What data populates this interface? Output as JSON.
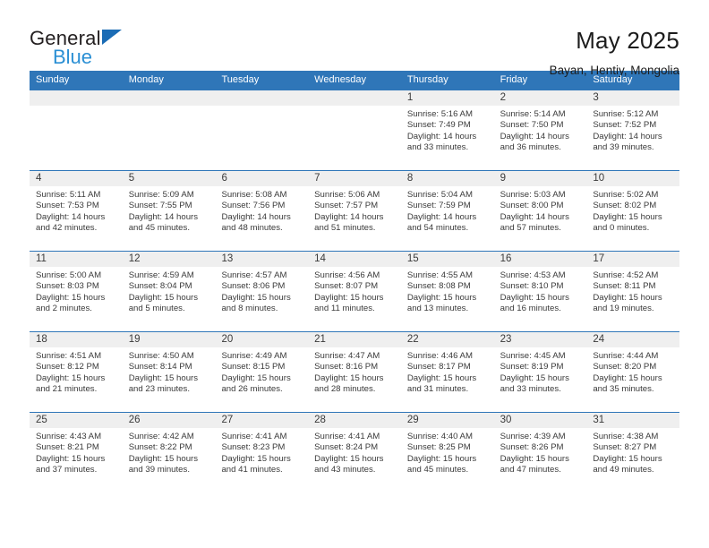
{
  "logo": {
    "word1": "General",
    "word2": "Blue",
    "triangle_color": "#1b6cb5",
    "word2_color": "#2a8fd4"
  },
  "header": {
    "title": "May 2025",
    "subtitle": "Bayan, Hentiy, Mongolia"
  },
  "theme": {
    "header_blue": "#2f76b8",
    "datebar_gray": "#efefef",
    "text_gray": "#3a3a3a"
  },
  "weekdays": [
    "Sunday",
    "Monday",
    "Tuesday",
    "Wednesday",
    "Thursday",
    "Friday",
    "Saturday"
  ],
  "labels": {
    "sunrise": "Sunrise:",
    "sunset": "Sunset:",
    "daylight": "Daylight:"
  },
  "weeks": [
    [
      {
        "day": "",
        "empty": true
      },
      {
        "day": "",
        "empty": true
      },
      {
        "day": "",
        "empty": true
      },
      {
        "day": "",
        "empty": true
      },
      {
        "day": "1",
        "sunrise": "Sunrise: 5:16 AM",
        "sunset": "Sunset: 7:49 PM",
        "daylight1": "Daylight: 14 hours",
        "daylight2": "and 33 minutes."
      },
      {
        "day": "2",
        "sunrise": "Sunrise: 5:14 AM",
        "sunset": "Sunset: 7:50 PM",
        "daylight1": "Daylight: 14 hours",
        "daylight2": "and 36 minutes."
      },
      {
        "day": "3",
        "sunrise": "Sunrise: 5:12 AM",
        "sunset": "Sunset: 7:52 PM",
        "daylight1": "Daylight: 14 hours",
        "daylight2": "and 39 minutes."
      }
    ],
    [
      {
        "day": "4",
        "sunrise": "Sunrise: 5:11 AM",
        "sunset": "Sunset: 7:53 PM",
        "daylight1": "Daylight: 14 hours",
        "daylight2": "and 42 minutes."
      },
      {
        "day": "5",
        "sunrise": "Sunrise: 5:09 AM",
        "sunset": "Sunset: 7:55 PM",
        "daylight1": "Daylight: 14 hours",
        "daylight2": "and 45 minutes."
      },
      {
        "day": "6",
        "sunrise": "Sunrise: 5:08 AM",
        "sunset": "Sunset: 7:56 PM",
        "daylight1": "Daylight: 14 hours",
        "daylight2": "and 48 minutes."
      },
      {
        "day": "7",
        "sunrise": "Sunrise: 5:06 AM",
        "sunset": "Sunset: 7:57 PM",
        "daylight1": "Daylight: 14 hours",
        "daylight2": "and 51 minutes."
      },
      {
        "day": "8",
        "sunrise": "Sunrise: 5:04 AM",
        "sunset": "Sunset: 7:59 PM",
        "daylight1": "Daylight: 14 hours",
        "daylight2": "and 54 minutes."
      },
      {
        "day": "9",
        "sunrise": "Sunrise: 5:03 AM",
        "sunset": "Sunset: 8:00 PM",
        "daylight1": "Daylight: 14 hours",
        "daylight2": "and 57 minutes."
      },
      {
        "day": "10",
        "sunrise": "Sunrise: 5:02 AM",
        "sunset": "Sunset: 8:02 PM",
        "daylight1": "Daylight: 15 hours",
        "daylight2": "and 0 minutes."
      }
    ],
    [
      {
        "day": "11",
        "sunrise": "Sunrise: 5:00 AM",
        "sunset": "Sunset: 8:03 PM",
        "daylight1": "Daylight: 15 hours",
        "daylight2": "and 2 minutes."
      },
      {
        "day": "12",
        "sunrise": "Sunrise: 4:59 AM",
        "sunset": "Sunset: 8:04 PM",
        "daylight1": "Daylight: 15 hours",
        "daylight2": "and 5 minutes."
      },
      {
        "day": "13",
        "sunrise": "Sunrise: 4:57 AM",
        "sunset": "Sunset: 8:06 PM",
        "daylight1": "Daylight: 15 hours",
        "daylight2": "and 8 minutes."
      },
      {
        "day": "14",
        "sunrise": "Sunrise: 4:56 AM",
        "sunset": "Sunset: 8:07 PM",
        "daylight1": "Daylight: 15 hours",
        "daylight2": "and 11 minutes."
      },
      {
        "day": "15",
        "sunrise": "Sunrise: 4:55 AM",
        "sunset": "Sunset: 8:08 PM",
        "daylight1": "Daylight: 15 hours",
        "daylight2": "and 13 minutes."
      },
      {
        "day": "16",
        "sunrise": "Sunrise: 4:53 AM",
        "sunset": "Sunset: 8:10 PM",
        "daylight1": "Daylight: 15 hours",
        "daylight2": "and 16 minutes."
      },
      {
        "day": "17",
        "sunrise": "Sunrise: 4:52 AM",
        "sunset": "Sunset: 8:11 PM",
        "daylight1": "Daylight: 15 hours",
        "daylight2": "and 19 minutes."
      }
    ],
    [
      {
        "day": "18",
        "sunrise": "Sunrise: 4:51 AM",
        "sunset": "Sunset: 8:12 PM",
        "daylight1": "Daylight: 15 hours",
        "daylight2": "and 21 minutes."
      },
      {
        "day": "19",
        "sunrise": "Sunrise: 4:50 AM",
        "sunset": "Sunset: 8:14 PM",
        "daylight1": "Daylight: 15 hours",
        "daylight2": "and 23 minutes."
      },
      {
        "day": "20",
        "sunrise": "Sunrise: 4:49 AM",
        "sunset": "Sunset: 8:15 PM",
        "daylight1": "Daylight: 15 hours",
        "daylight2": "and 26 minutes."
      },
      {
        "day": "21",
        "sunrise": "Sunrise: 4:47 AM",
        "sunset": "Sunset: 8:16 PM",
        "daylight1": "Daylight: 15 hours",
        "daylight2": "and 28 minutes."
      },
      {
        "day": "22",
        "sunrise": "Sunrise: 4:46 AM",
        "sunset": "Sunset: 8:17 PM",
        "daylight1": "Daylight: 15 hours",
        "daylight2": "and 31 minutes."
      },
      {
        "day": "23",
        "sunrise": "Sunrise: 4:45 AM",
        "sunset": "Sunset: 8:19 PM",
        "daylight1": "Daylight: 15 hours",
        "daylight2": "and 33 minutes."
      },
      {
        "day": "24",
        "sunrise": "Sunrise: 4:44 AM",
        "sunset": "Sunset: 8:20 PM",
        "daylight1": "Daylight: 15 hours",
        "daylight2": "and 35 minutes."
      }
    ],
    [
      {
        "day": "25",
        "sunrise": "Sunrise: 4:43 AM",
        "sunset": "Sunset: 8:21 PM",
        "daylight1": "Daylight: 15 hours",
        "daylight2": "and 37 minutes."
      },
      {
        "day": "26",
        "sunrise": "Sunrise: 4:42 AM",
        "sunset": "Sunset: 8:22 PM",
        "daylight1": "Daylight: 15 hours",
        "daylight2": "and 39 minutes."
      },
      {
        "day": "27",
        "sunrise": "Sunrise: 4:41 AM",
        "sunset": "Sunset: 8:23 PM",
        "daylight1": "Daylight: 15 hours",
        "daylight2": "and 41 minutes."
      },
      {
        "day": "28",
        "sunrise": "Sunrise: 4:41 AM",
        "sunset": "Sunset: 8:24 PM",
        "daylight1": "Daylight: 15 hours",
        "daylight2": "and 43 minutes."
      },
      {
        "day": "29",
        "sunrise": "Sunrise: 4:40 AM",
        "sunset": "Sunset: 8:25 PM",
        "daylight1": "Daylight: 15 hours",
        "daylight2": "and 45 minutes."
      },
      {
        "day": "30",
        "sunrise": "Sunrise: 4:39 AM",
        "sunset": "Sunset: 8:26 PM",
        "daylight1": "Daylight: 15 hours",
        "daylight2": "and 47 minutes."
      },
      {
        "day": "31",
        "sunrise": "Sunrise: 4:38 AM",
        "sunset": "Sunset: 8:27 PM",
        "daylight1": "Daylight: 15 hours",
        "daylight2": "and 49 minutes."
      }
    ]
  ]
}
